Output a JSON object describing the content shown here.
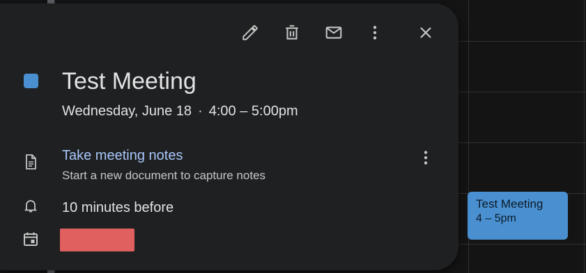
{
  "calendar_event_chip": {
    "title": "Test Meeting",
    "time": "4 – 5pm",
    "color": "#4a90d0"
  },
  "popup": {
    "toolbar": {
      "edit_icon": "pencil-icon",
      "delete_icon": "trash-icon",
      "email_icon": "mail-icon",
      "more_icon": "more-vert-icon",
      "close_icon": "close-icon"
    },
    "event": {
      "color": "#4a90d0",
      "title": "Test Meeting",
      "date": "Wednesday, June 18",
      "separator": "·",
      "time": "4:00 – 5:00pm"
    },
    "notes": {
      "icon": "document-icon",
      "link_label": "Take meeting notes",
      "subtitle": "Start a new document to capture notes",
      "more_icon": "more-vert-icon"
    },
    "reminder": {
      "icon": "bell-icon",
      "text": "10 minutes before"
    },
    "calendar": {
      "icon": "calendar-event-icon",
      "redacted_color": "#e06060"
    }
  }
}
